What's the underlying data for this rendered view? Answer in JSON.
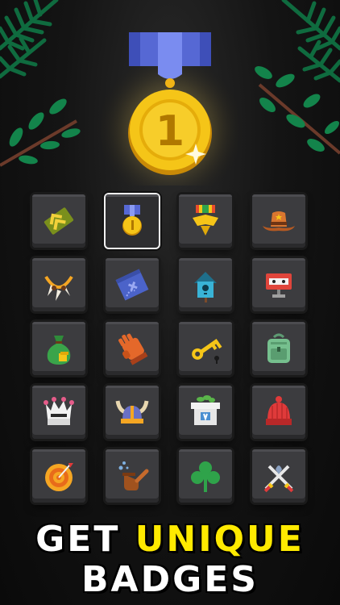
{
  "caption": {
    "word1": "GET",
    "word2": "UNIQUE",
    "word3": "BADGES",
    "color_primary": "#ffffff",
    "color_accent": "#ffea00"
  },
  "medal": {
    "number": "1",
    "gold": "#f5c518",
    "ribbon": "#5a6fd8"
  },
  "badges": [
    {
      "icon": "rank-chevrons-badge-icon"
    },
    {
      "icon": "medal-badge-icon",
      "selected": true
    },
    {
      "icon": "military-order-badge-icon"
    },
    {
      "icon": "cowboy-hat-badge-icon"
    },
    {
      "icon": "claw-necklace-badge-icon"
    },
    {
      "icon": "treasure-map-badge-icon"
    },
    {
      "icon": "birdhouse-badge-icon"
    },
    {
      "icon": "robot-head-badge-icon"
    },
    {
      "icon": "money-bag-badge-icon"
    },
    {
      "icon": "leather-glove-badge-icon"
    },
    {
      "icon": "golden-key-badge-icon"
    },
    {
      "icon": "backpack-badge-icon"
    },
    {
      "icon": "crown-badge-icon"
    },
    {
      "icon": "viking-helmet-badge-icon"
    },
    {
      "icon": "flower-pot-badge-icon"
    },
    {
      "icon": "knit-hat-badge-icon"
    },
    {
      "icon": "target-badge-icon"
    },
    {
      "icon": "tobacco-pipe-badge-icon"
    },
    {
      "icon": "clover-badge-icon"
    },
    {
      "icon": "crossed-swords-badge-icon"
    }
  ]
}
